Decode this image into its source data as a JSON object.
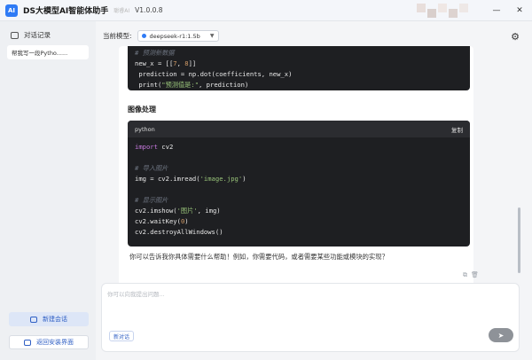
{
  "titlebar": {
    "title": "DS大模型AI智能体助手",
    "subtitle": "聪睿AI",
    "version": "V1.0.0.8",
    "minimize": "—",
    "close": "✕"
  },
  "sidebar": {
    "header": "对话记录",
    "conversations": [
      "帮我写一段Pytho......"
    ],
    "new_chat": "新建会话",
    "back_install": "返回安装界面"
  },
  "main": {
    "model_label": "当前模型:",
    "model_value": "deepseek-r1:1.5b",
    "settings_icon": "gear-icon"
  },
  "chat": {
    "prev_code": [
      "# 预测新数据",
      "new_x = [[7, 8]]",
      " prediction = np.dot(coefficients, new_x)",
      " print(\"预测值是:\", prediction)"
    ],
    "section_title": "图像处理",
    "code_lang": "python",
    "code_copy": "复制",
    "code_lines": [
      "import cv2",
      "",
      "# 导入图片",
      "img = cv2.imread('image.jpg')",
      "",
      "# 显示图片",
      "cv2.imshow('图片', img)",
      "cv2.waitKey(0)",
      "cv2.destroyAllWindows()"
    ],
    "answer": "你可以告诉我你具体需要什么帮助！例如，你需要代码，或者需要某些功能或模块的实现？"
  },
  "input": {
    "placeholder": "你可以向我提出问题...",
    "new_topic": "新对话",
    "send_icon": "send-icon"
  },
  "colors": {
    "accent": "#2f7bf5",
    "code_bg": "#1e1f22",
    "keyword": "#c678dd",
    "string": "#98c379",
    "number": "#d19a66",
    "comment": "#6d7480"
  }
}
